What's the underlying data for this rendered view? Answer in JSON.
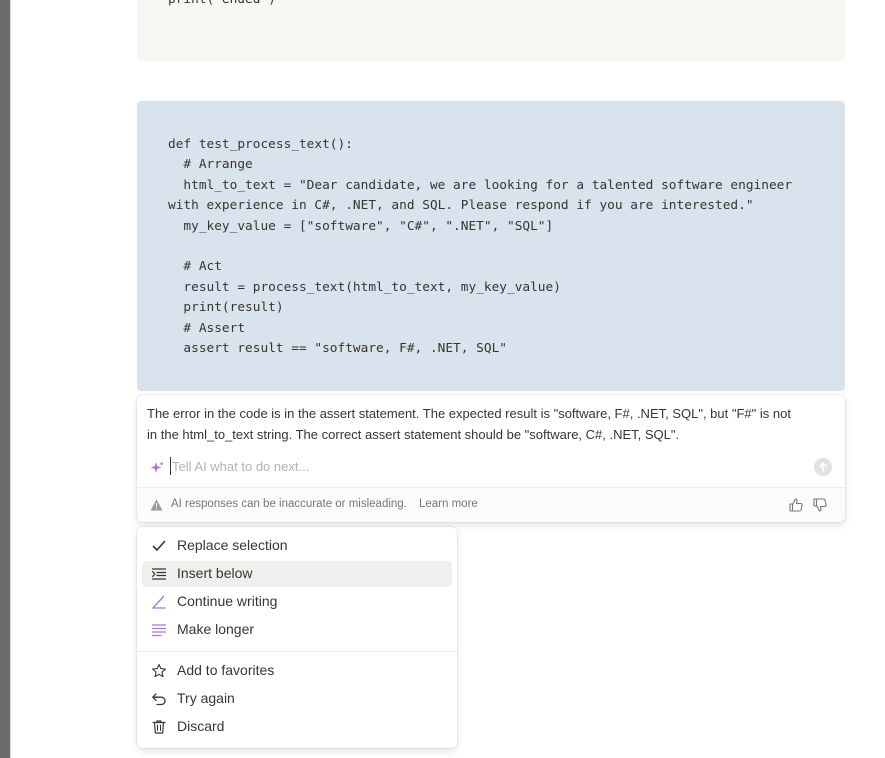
{
  "editor": {
    "prev_code_tail": "print(\"ended\")",
    "code_lines": [
      "def test_process_text():",
      "  # Arrange",
      "  html_to_text = \"Dear candidate, we are looking for a talented software engineer",
      "with experience in C#, .NET, and SQL. Please respond if you are interested.\"",
      "  my_key_value = [\"software\", \"C#\", \".NET\", \"SQL\"]",
      "",
      "  # Act",
      "  result = process_text(html_to_text, my_key_value)",
      "  print(result)",
      "  # Assert",
      "  assert result == \"software, F#, .NET, SQL\""
    ]
  },
  "ai_panel": {
    "response_line1": "The error in the code is in the assert statement. The expected result is \"software, F#, .NET, SQL\", but \"F#\" is not",
    "response_line2": "in the html_to_text string. The correct assert statement should be \"software, C#, .NET, SQL\".",
    "input_placeholder": "Tell AI what to do next...",
    "input_value": "",
    "disclaimer": "AI responses can be inaccurate or misleading.",
    "learn_more": "Learn more",
    "icons": {
      "sparkle": "sparkle-icon",
      "submit": "arrow-up-icon",
      "warning": "warning-icon",
      "thumb_up": "thumb-up-icon",
      "thumb_down": "thumb-down-icon"
    }
  },
  "menu": {
    "items": [
      {
        "label": "Replace selection",
        "icon": "check-icon",
        "active": false
      },
      {
        "label": "Insert below",
        "icon": "insert-below-icon",
        "active": true
      },
      {
        "label": "Continue writing",
        "icon": "pen-icon",
        "active": false
      },
      {
        "label": "Make longer",
        "icon": "lines-icon",
        "active": false
      },
      {
        "label": "Add to favorites",
        "icon": "star-icon",
        "active": false
      },
      {
        "label": "Try again",
        "icon": "undo-arrow-icon",
        "active": false
      },
      {
        "label": "Discard",
        "icon": "trash-icon",
        "active": false
      }
    ]
  },
  "colors": {
    "code_block_bg": "#d8e3ee",
    "prev_code_block_bg": "#f7f6f3",
    "ai_accent": "#a177d8",
    "text": "#37352f",
    "muted": "#787774"
  }
}
